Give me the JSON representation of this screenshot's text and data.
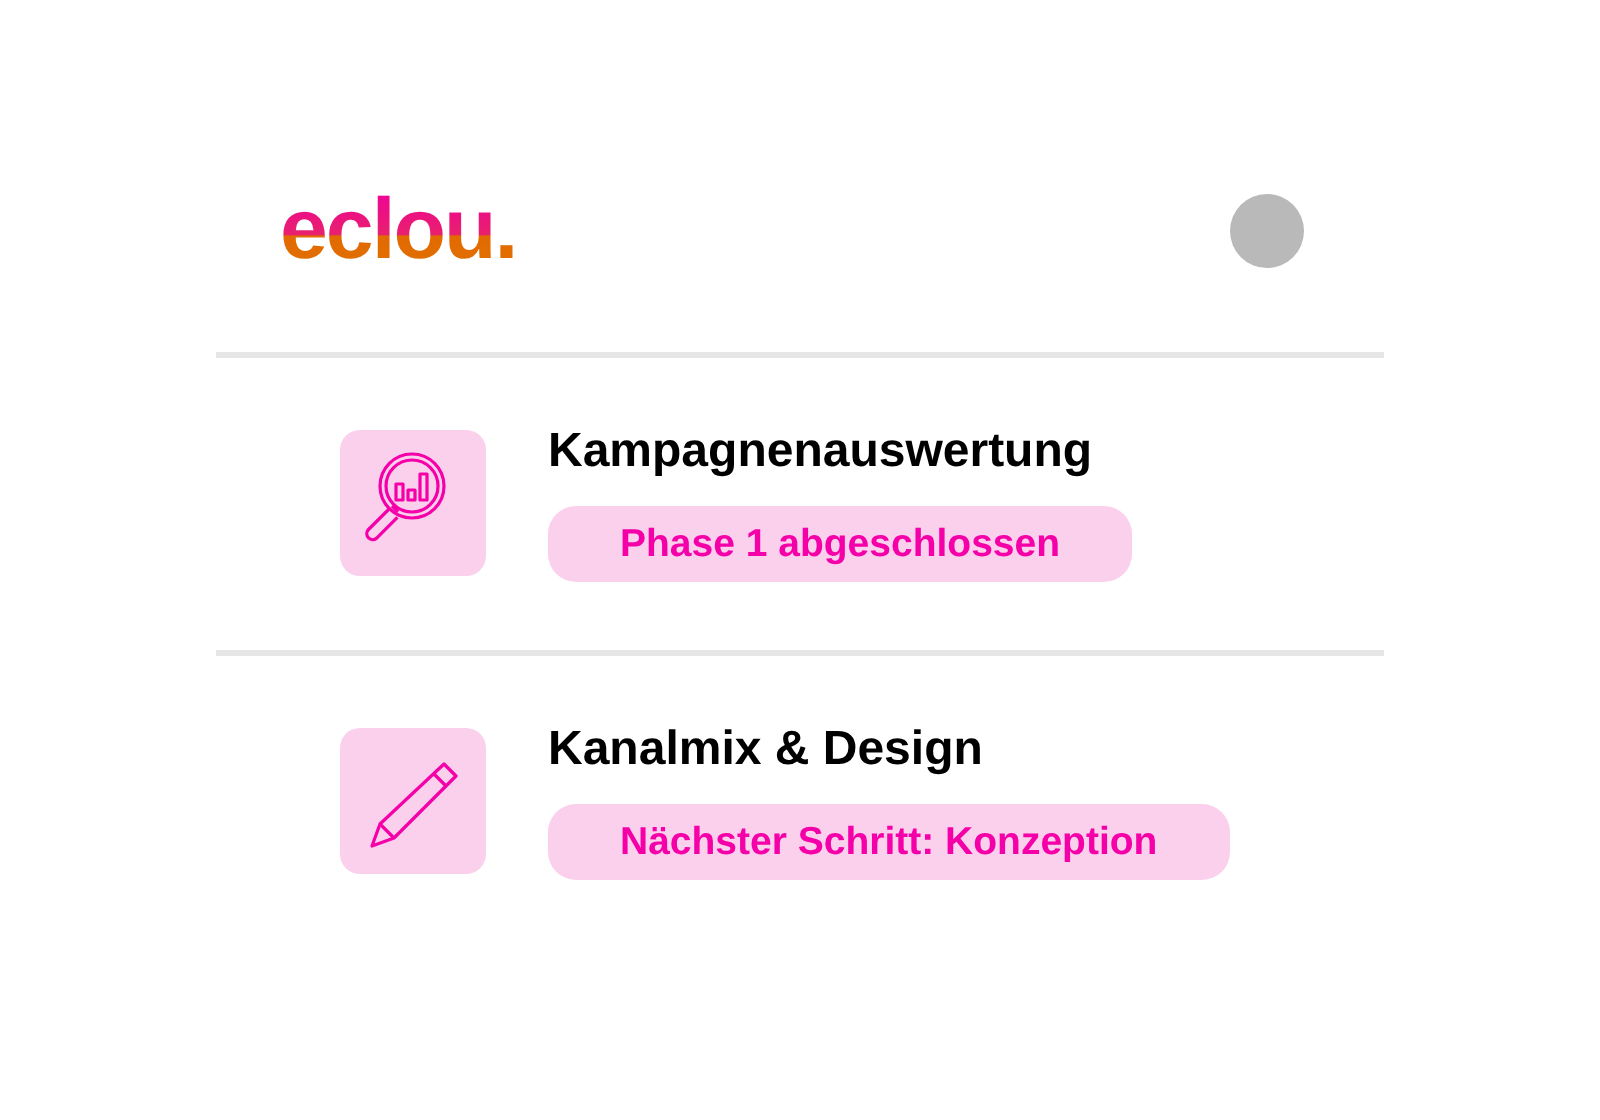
{
  "header": {
    "logo": "eclou.",
    "avatar": true
  },
  "items": [
    {
      "kind": "analysis",
      "title": "Kampagnenauswertung",
      "status": "Phase 1 abgeschlossen"
    },
    {
      "kind": "pencil",
      "title": "Kanalmix & Design",
      "status": "Nächster Schritt: Konzeption"
    }
  ]
}
